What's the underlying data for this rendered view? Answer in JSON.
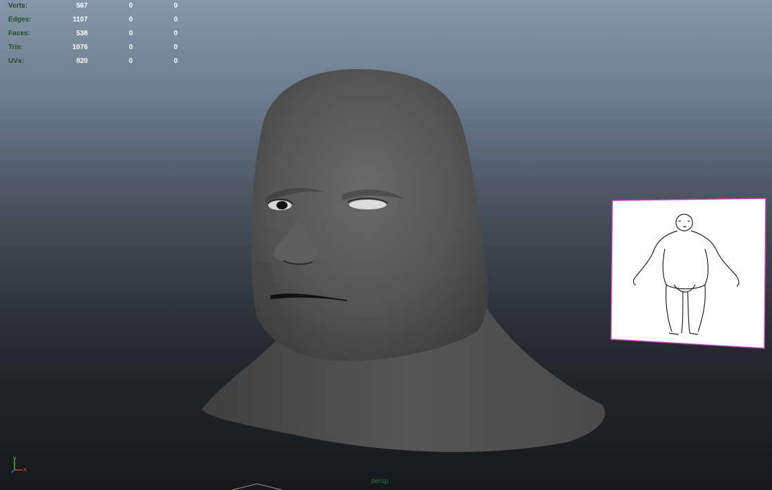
{
  "hud": {
    "rows": [
      {
        "label": "Verts:",
        "v1": "567",
        "v2": "0",
        "v3": "0"
      },
      {
        "label": "Edges:",
        "v1": "1107",
        "v2": "0",
        "v3": "0"
      },
      {
        "label": "Faces:",
        "v1": "538",
        "v2": "0",
        "v3": "0"
      },
      {
        "label": "Tris:",
        "v1": "1076",
        "v2": "0",
        "v3": "0"
      },
      {
        "label": "UVs:",
        "v1": "820",
        "v2": "0",
        "v3": "0"
      }
    ]
  },
  "camera": {
    "name": "persp"
  },
  "axis": {
    "y_label": "y",
    "x_label": "x"
  },
  "colors": {
    "hud_label": "#1f4e2c",
    "hud_value": "#ffffff",
    "image_plane_border": "#c040c0",
    "mesh": "#5a5a5a"
  }
}
